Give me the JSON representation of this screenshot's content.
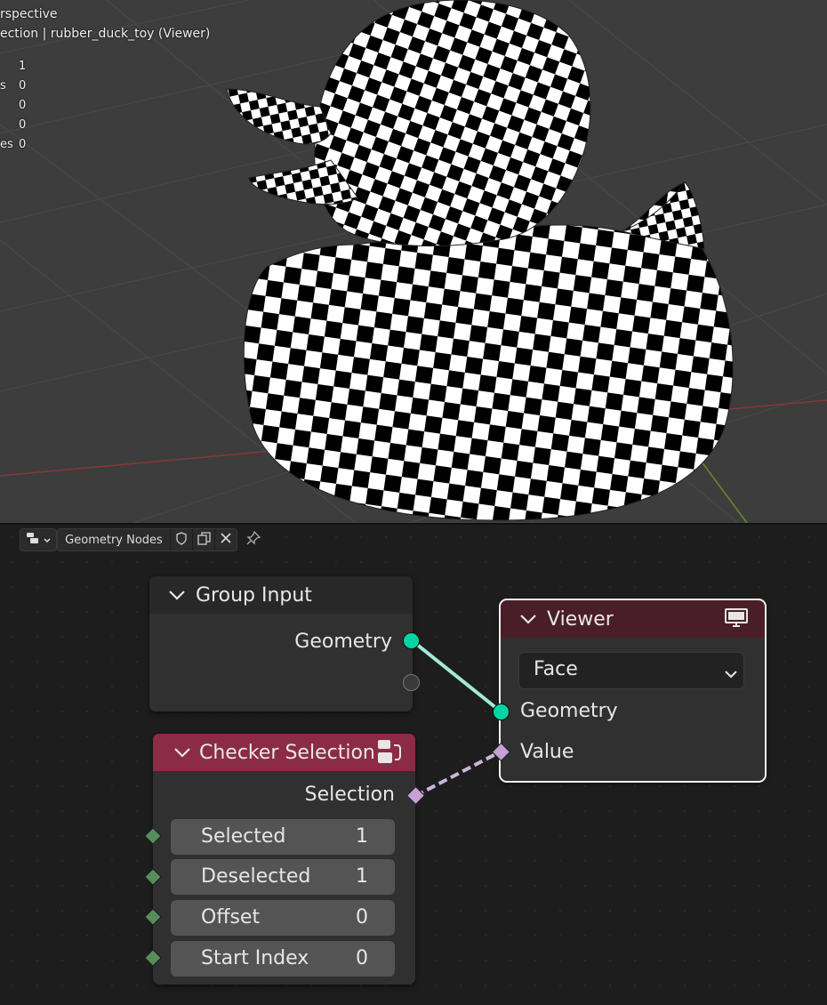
{
  "viewport": {
    "mode_label": "rspective",
    "object_label": "ection | rubber_duck_toy (Viewer)",
    "stats": [
      {
        "label": "",
        "value": "1"
      },
      {
        "label": "s",
        "value": "0"
      },
      {
        "label": "",
        "value": "0"
      },
      {
        "label": "",
        "value": "0"
      },
      {
        "label": "es",
        "value": "0"
      }
    ]
  },
  "node_editor": {
    "tree_name": "Geometry Nodes",
    "icons": [
      "editor-type-icon",
      "chevron-down-icon",
      "fake-user-shield-icon",
      "duplicate-icon",
      "close-icon",
      "pin-icon"
    ]
  },
  "nodes": {
    "group_input": {
      "title": "Group Input",
      "outputs": [
        "Geometry"
      ]
    },
    "viewer": {
      "title": "Viewer",
      "domain": "Face",
      "inputs": [
        "Geometry",
        "Value"
      ],
      "header_color": "#4a1e28"
    },
    "checker": {
      "title": "Checker Selection",
      "output": "Selection",
      "header_color": "#8c2b45",
      "fields": [
        {
          "label": "Selected",
          "value": "1"
        },
        {
          "label": "Deselected",
          "value": "1"
        },
        {
          "label": "Offset",
          "value": "0"
        },
        {
          "label": "Start Index",
          "value": "0"
        }
      ]
    }
  },
  "colors": {
    "geometry_socket": "#00d6a3",
    "float_socket": "#c7a1d6",
    "int_socket": "#598c5c",
    "link_geometry": "#a3ead6"
  }
}
